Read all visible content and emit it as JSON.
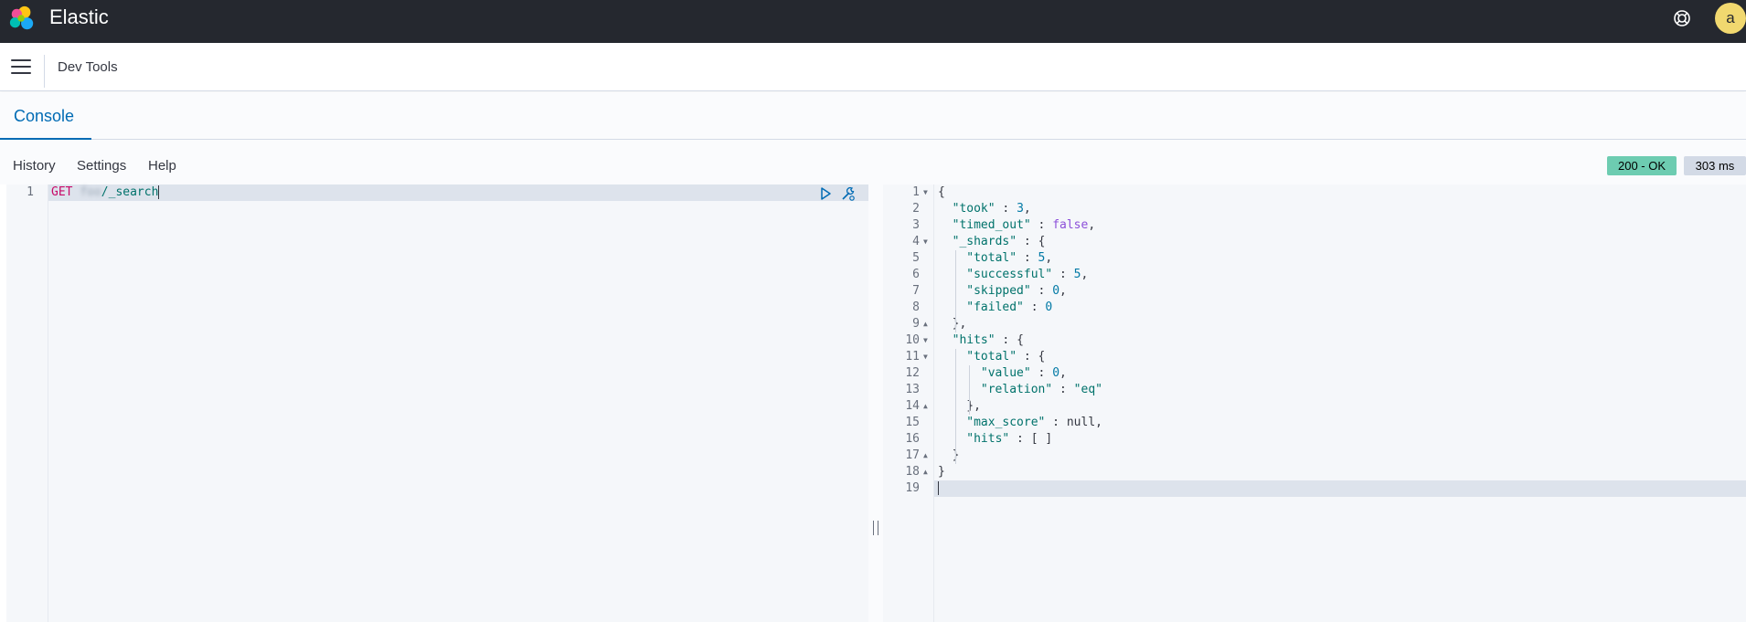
{
  "header": {
    "brand": "Elastic",
    "avatar_letter": "a",
    "help_icon": "help-lifebuoy-icon",
    "logo_icon": "elastic-logo-icon"
  },
  "navbar": {
    "menu_icon": "hamburger-menu-icon",
    "breadcrumb": "Dev Tools"
  },
  "tabs": [
    {
      "label": "Console",
      "active": true
    }
  ],
  "toolbar": {
    "history": "History",
    "settings": "Settings",
    "help": "Help"
  },
  "status": {
    "code": "200 - OK",
    "time": "303 ms",
    "code_color": "#6dccb1",
    "time_color": "#d3dae6"
  },
  "request": {
    "line_number": "1",
    "method": "GET",
    "index_obscured": "foo",
    "path": "/_search"
  },
  "response": {
    "line_numbers": [
      "1",
      "2",
      "3",
      "4",
      "5",
      "6",
      "7",
      "8",
      "9",
      "10",
      "11",
      "12",
      "13",
      "14",
      "15",
      "16",
      "17",
      "18",
      "19"
    ],
    "lines": [
      {
        "text": "{"
      },
      {
        "key": "\"took\"",
        "sep": " : ",
        "val": "3",
        "vt": "n",
        "end": ","
      },
      {
        "key": "\"timed_out\"",
        "sep": " : ",
        "val": "false",
        "vt": "b",
        "end": ","
      },
      {
        "key": "\"_shards\"",
        "sep": " : ",
        "end": "{"
      },
      {
        "key": "\"total\"",
        "sep": " : ",
        "val": "5",
        "vt": "n",
        "end": ","
      },
      {
        "key": "\"successful\"",
        "sep": " : ",
        "val": "5",
        "vt": "n",
        "end": ","
      },
      {
        "key": "\"skipped\"",
        "sep": " : ",
        "val": "0",
        "vt": "n",
        "end": ","
      },
      {
        "key": "\"failed\"",
        "sep": " : ",
        "val": "0",
        "vt": "n",
        "end": ""
      },
      {
        "text": "},"
      },
      {
        "key": "\"hits\"",
        "sep": " : ",
        "end": "{"
      },
      {
        "key": "\"total\"",
        "sep": " : ",
        "end": "{"
      },
      {
        "key": "\"value\"",
        "sep": " : ",
        "val": "0",
        "vt": "n",
        "end": ","
      },
      {
        "key": "\"relation\"",
        "sep": " : ",
        "val": "\"eq\"",
        "vt": "s",
        "end": ""
      },
      {
        "text": "},"
      },
      {
        "key": "\"max_score\"",
        "sep": " : ",
        "val": "null",
        "vt": "",
        "end": ","
      },
      {
        "key": "\"hits\"",
        "sep": " : ",
        "val": "[ ]",
        "vt": "",
        "end": ""
      },
      {
        "text": "}"
      },
      {
        "text": "}"
      },
      {
        "text": ""
      }
    ]
  }
}
